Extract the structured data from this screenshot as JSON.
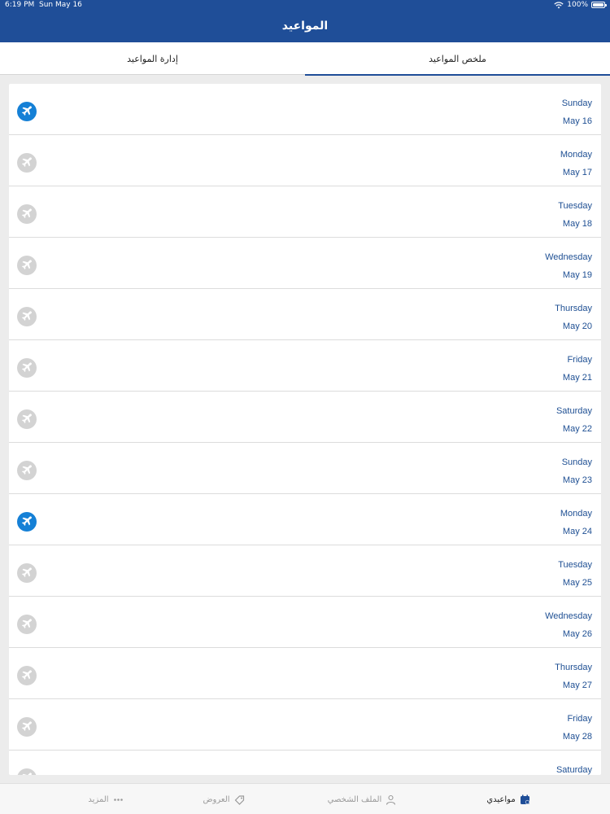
{
  "status_bar": {
    "time": "6:19 PM",
    "date": "Sun May 16",
    "battery_text": "100%"
  },
  "header": {
    "title": "المواعيد"
  },
  "tabs": [
    {
      "label": "إدارة المواعيد",
      "active": false
    },
    {
      "label": "ملخص المواعيد",
      "active": true
    }
  ],
  "schedule": [
    {
      "day": "Sunday",
      "date": "May 16",
      "has_flight": true
    },
    {
      "day": "Monday",
      "date": "May 17",
      "has_flight": false
    },
    {
      "day": "Tuesday",
      "date": "May 18",
      "has_flight": false
    },
    {
      "day": "Wednesday",
      "date": "May 19",
      "has_flight": false
    },
    {
      "day": "Thursday",
      "date": "May 20",
      "has_flight": false
    },
    {
      "day": "Friday",
      "date": "May 21",
      "has_flight": false
    },
    {
      "day": "Saturday",
      "date": "May 22",
      "has_flight": false
    },
    {
      "day": "Sunday",
      "date": "May 23",
      "has_flight": false
    },
    {
      "day": "Monday",
      "date": "May 24",
      "has_flight": true
    },
    {
      "day": "Tuesday",
      "date": "May 25",
      "has_flight": false
    },
    {
      "day": "Wednesday",
      "date": "May 26",
      "has_flight": false
    },
    {
      "day": "Thursday",
      "date": "May 27",
      "has_flight": false
    },
    {
      "day": "Friday",
      "date": "May 28",
      "has_flight": false
    },
    {
      "day": "Saturday",
      "date": "",
      "has_flight": false
    }
  ],
  "bottom_nav": [
    {
      "label": "المزيد",
      "icon": "more-dots-icon",
      "active": false
    },
    {
      "label": "العروض",
      "icon": "tag-icon",
      "active": false
    },
    {
      "label": "الملف الشخصي",
      "icon": "user-icon",
      "active": false
    },
    {
      "label": "مواعيدي",
      "icon": "calendar-icon",
      "active": true
    }
  ],
  "colors": {
    "header": "#1f4e98",
    "accent": "#1580d6",
    "text_blue": "#1e4f93",
    "inactive_icon": "#d3d3d3"
  }
}
